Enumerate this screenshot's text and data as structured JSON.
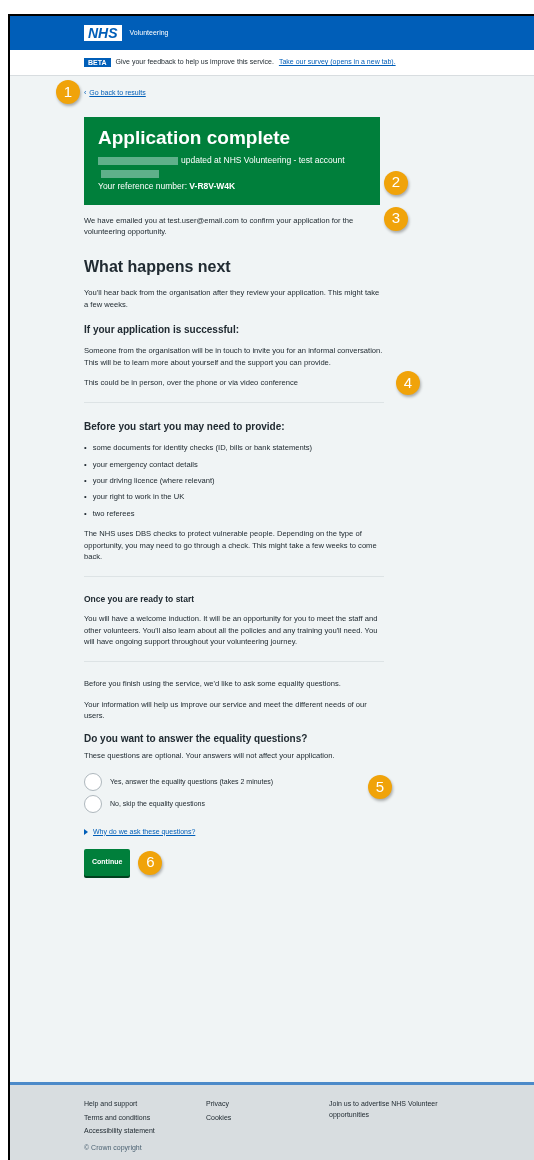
{
  "header": {
    "logo": "NHS",
    "service_name": "Volunteering"
  },
  "phase_banner": {
    "tag": "BETA",
    "text": "Give your feedback to help us improve this service.",
    "link": "Take our survey (opens in a new tab)."
  },
  "back_link": {
    "icon": "‹",
    "text": "Go back to results"
  },
  "panel": {
    "title": "Application complete",
    "body": [
      {
        "kind": "redacted"
      },
      {
        "kind": "text",
        "text": "updated at NHS Volunteering - test account"
      },
      {
        "kind": "redacted"
      }
    ],
    "reference": "Your reference number: **V-R8V-W4K**"
  },
  "email_confirmation": "We have emailed you at test.user@email.com to confirm your application for the volunteering opportunity.",
  "sections": [
    {
      "heading": "What happens next",
      "kind": "major",
      "paragraphs": [
        "You'll hear back from the organisation after they review your application. This might take a few weeks."
      ],
      "divider": false
    },
    {
      "heading": "If your application is successful:",
      "kind": "minor",
      "paragraphs": [
        "Someone from the organisation will be in touch to invite you for an informal conversation. This will be to learn more about yourself and the support you can provide.",
        "This could be in person, over the phone or via video conference"
      ],
      "divider": true
    },
    {
      "heading": "Before you start you may need to provide:",
      "kind": "minor",
      "list": [
        {
          "marker": "•",
          "text": "some documents for identity checks (ID, bills or bank statements)"
        },
        {
          "marker": "•",
          "text": "your emergency contact details"
        },
        {
          "marker": "•",
          "text": "your driving licence (where relevant)"
        },
        {
          "marker": "•",
          "text": "your right to work in the UK"
        },
        {
          "marker": "•",
          "text": "two referees"
        }
      ],
      "paragraphs": [
        "The NHS uses DBS checks to protect vulnerable people. Depending on the type of opportunity, you may need to go through a check. This might take a few weeks to come back."
      ],
      "divider": true
    },
    {
      "heading": "Once you are ready to start",
      "kind": "small",
      "paragraphs": [
        "You will have a welcome induction. It will be an opportunity for you to meet the staff and other volunteers. You'll also learn about all the policies and any training you'll need. You will have ongoing support throughout your volunteering journey."
      ],
      "divider": true
    },
    {
      "kind": "plain",
      "paragraphs": [
        "Before you finish using the service, we'd like to ask some equality questions.",
        "Your information will help us improve our service and meet the different needs of our users."
      ],
      "divider": false
    }
  ],
  "question": {
    "legend": "Do you want to answer the equality questions?",
    "hint": "These questions are optional. Your answers will not affect your application.",
    "options": [
      {
        "label": "Yes, answer the equality questions (takes 2 minutes)",
        "selected": false
      },
      {
        "label": "No, skip the equality questions",
        "selected": false
      }
    ]
  },
  "details_link": "Why do we ask these questions?",
  "continue_button": "Continue",
  "callouts": [
    "1",
    "2",
    "3",
    "4",
    "5",
    "6"
  ],
  "footer": {
    "columns": [
      [
        "Help and support",
        "Terms and conditions",
        "Accessibility statement"
      ],
      [
        "Privacy",
        "Cookies"
      ],
      [
        "Join us to advertise NHS Volunteer opportunities"
      ]
    ],
    "copyright": "© Crown copyright"
  }
}
